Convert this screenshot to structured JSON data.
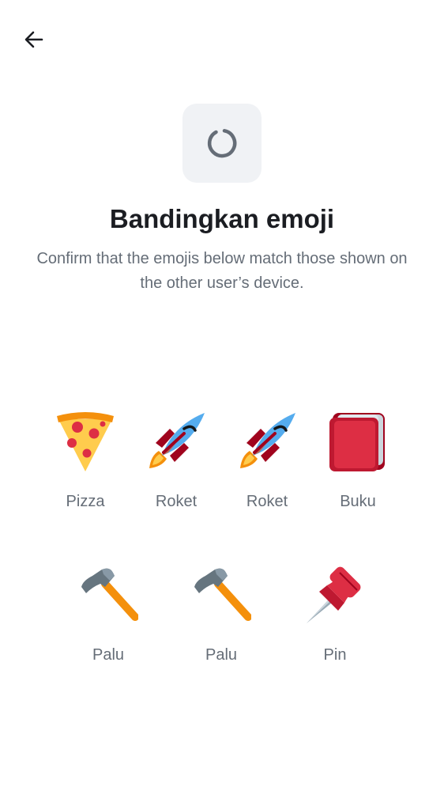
{
  "header": {
    "back_icon": "arrow-left-icon"
  },
  "status": {
    "icon": "spinner-icon"
  },
  "title": "Bandingkan emoji",
  "description": "Confirm that the emojis below match those shown on the other user’s device.",
  "emojis": [
    {
      "icon": "pizza-icon",
      "label": "Pizza"
    },
    {
      "icon": "rocket-icon",
      "label": "Roket"
    },
    {
      "icon": "rocket-icon",
      "label": "Roket"
    },
    {
      "icon": "book-icon",
      "label": "Buku"
    },
    {
      "icon": "hammer-icon",
      "label": "Palu"
    },
    {
      "icon": "hammer-icon",
      "label": "Palu"
    },
    {
      "icon": "pin-icon",
      "label": "Pin"
    }
  ],
  "colors": {
    "spinner": "#656d77",
    "spinner_bg": "#f0f2f5",
    "secondary_text": "#656d77",
    "primary_text": "#1b1d22"
  }
}
